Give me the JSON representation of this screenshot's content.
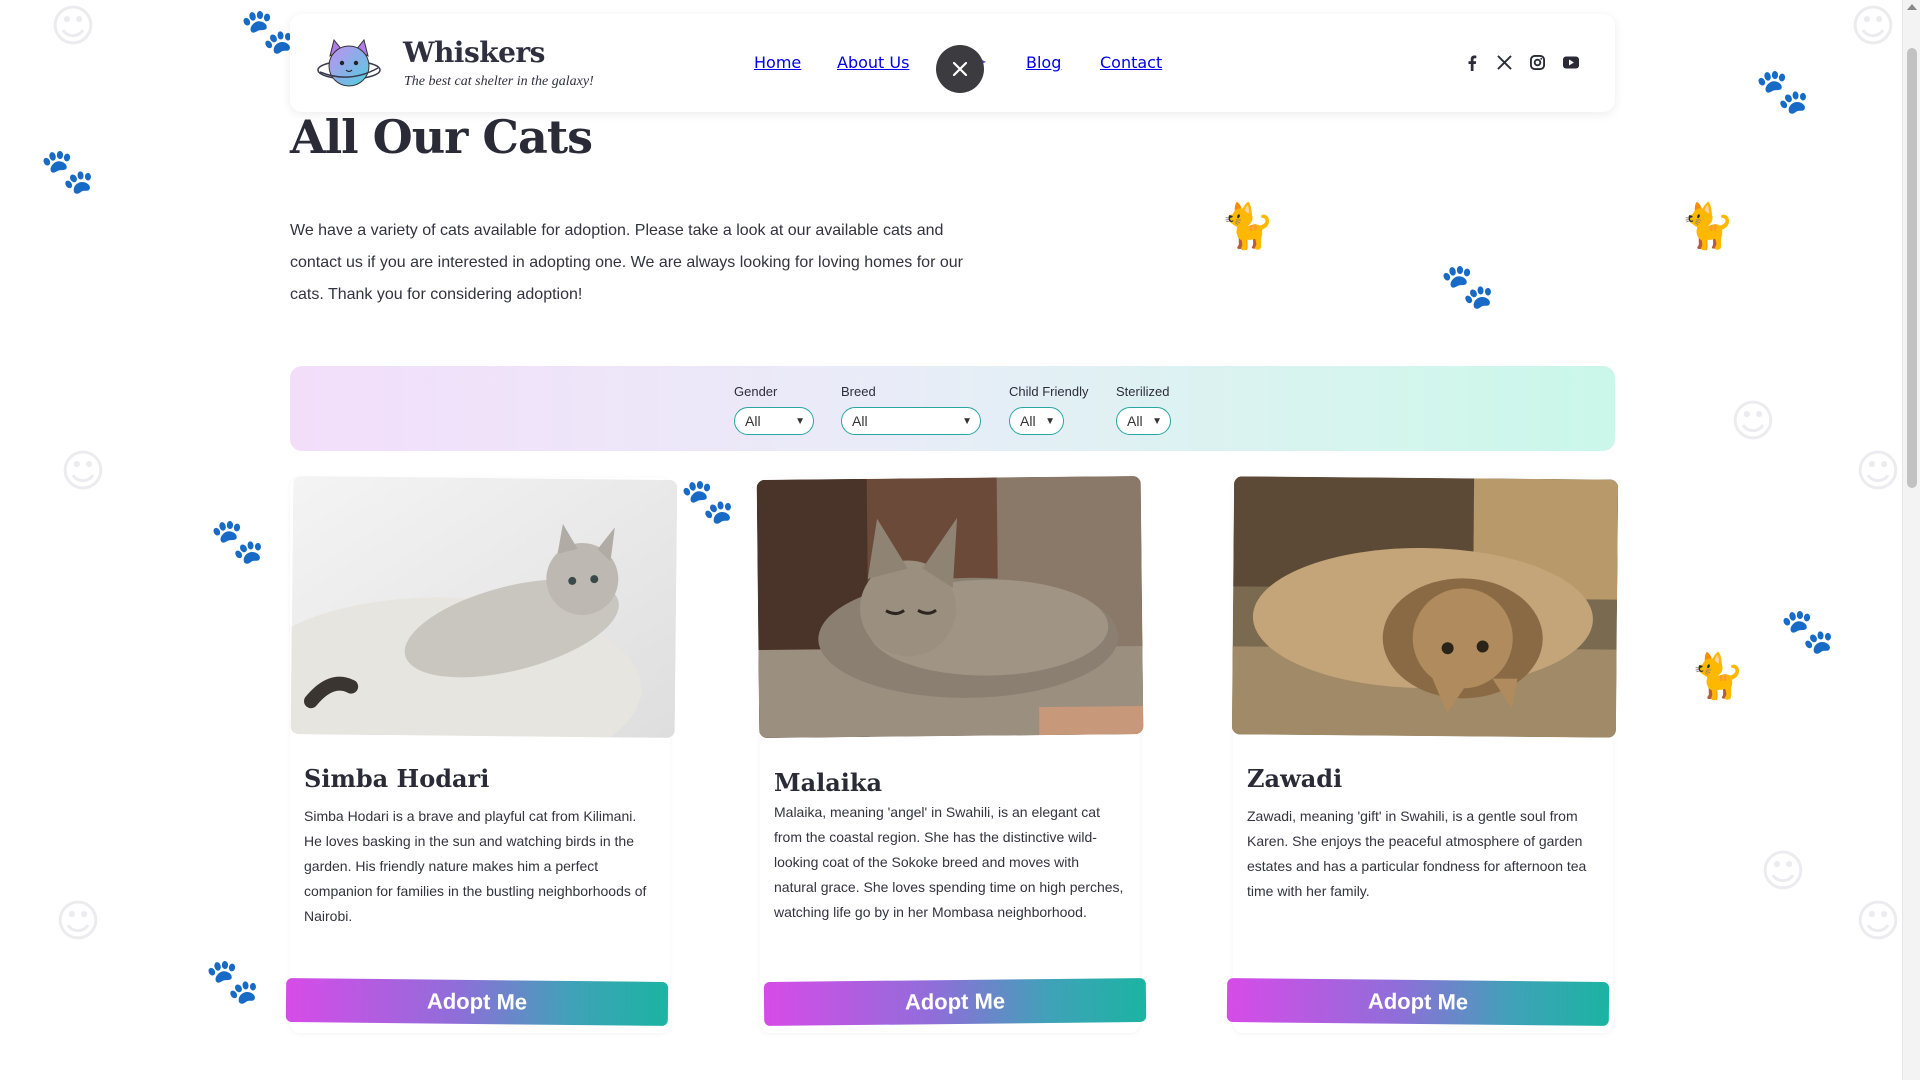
{
  "header": {
    "brand_name": "Whiskers",
    "tagline": "The best cat shelter in the galaxy!",
    "nav": [
      "Home",
      "About Us",
      "Blog",
      "Contact"
    ],
    "social_icons": [
      "facebook-icon",
      "x-icon",
      "instagram-icon",
      "youtube-icon"
    ]
  },
  "page": {
    "title": "All Our Cats",
    "intro": "We have a variety of cats available for adoption. Please take a look at our available cats and contact us if you are interested in adopting one. We are always looking for loving homes for our cats. Thank you for considering adoption!"
  },
  "filters": [
    {
      "label": "Gender",
      "value": "All"
    },
    {
      "label": "Breed",
      "value": "All"
    },
    {
      "label": "Child Friendly",
      "value": "All"
    },
    {
      "label": "Sterilized",
      "value": "All"
    }
  ],
  "cats": [
    {
      "name": "Simba Hodari",
      "description": "Simba Hodari is a brave and playful cat from Kilimani. He loves basking in the sun and watching birds in the garden. His friendly nature makes him a perfect companion for families in the bustling neighborhoods of Nairobi.",
      "button": "Adopt Me"
    },
    {
      "name": "Malaika",
      "description": "Malaika, meaning 'angel' in Swahili, is an elegant cat from the coastal region. She has the distinctive wild-looking coat of the Sokoke breed and moves with natural grace. She loves spending time on high perches, watching life go by in her Mombasa neighborhood.",
      "button": "Adopt Me"
    },
    {
      "name": "Zawadi",
      "description": "Zawadi, meaning 'gift' in Swahili, is a gentle soul from Karen. She enjoys the peaceful atmosphere of garden estates and has a particular fondness for afternoon tea time with her family.",
      "button": "Adopt Me"
    }
  ],
  "colors": {
    "accent_teal": "#1bb4a2",
    "accent_magenta": "#d74be8",
    "text_dark": "#2b2b38"
  }
}
